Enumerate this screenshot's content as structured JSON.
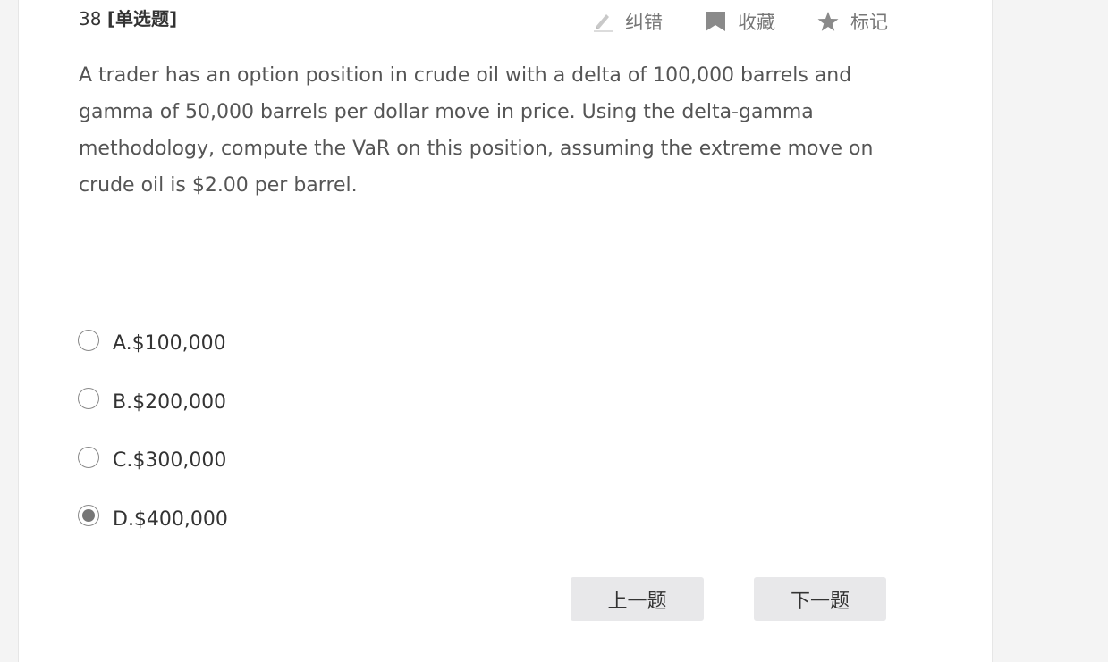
{
  "question": {
    "number": "38",
    "type": "[单选题]",
    "text": "A trader has an option position in crude oil with a delta of 100,000 barrels and gamma of 50,000 barrels per dollar move in price. Using the delta-gamma methodology, compute the VaR on this position, assuming the extreme move on crude oil is $2.00 per barrel."
  },
  "tools": {
    "report": {
      "label": "纠错",
      "icon": "pencil-icon"
    },
    "favorite": {
      "label": "收藏",
      "icon": "bookmark-icon"
    },
    "mark": {
      "label": "标记",
      "icon": "star-icon"
    }
  },
  "options": [
    {
      "label": "A.$100,000",
      "selected": false
    },
    {
      "label": "B.$200,000",
      "selected": false
    },
    {
      "label": "C.$300,000",
      "selected": false
    },
    {
      "label": "D.$400,000",
      "selected": true
    }
  ],
  "nav": {
    "prev_label": "上一题",
    "next_label": "下一题"
  },
  "colors": {
    "background": "#f4f4f4",
    "card": "#ffffff",
    "button": "#e8e8ea",
    "icon": "#8a8a8a"
  }
}
